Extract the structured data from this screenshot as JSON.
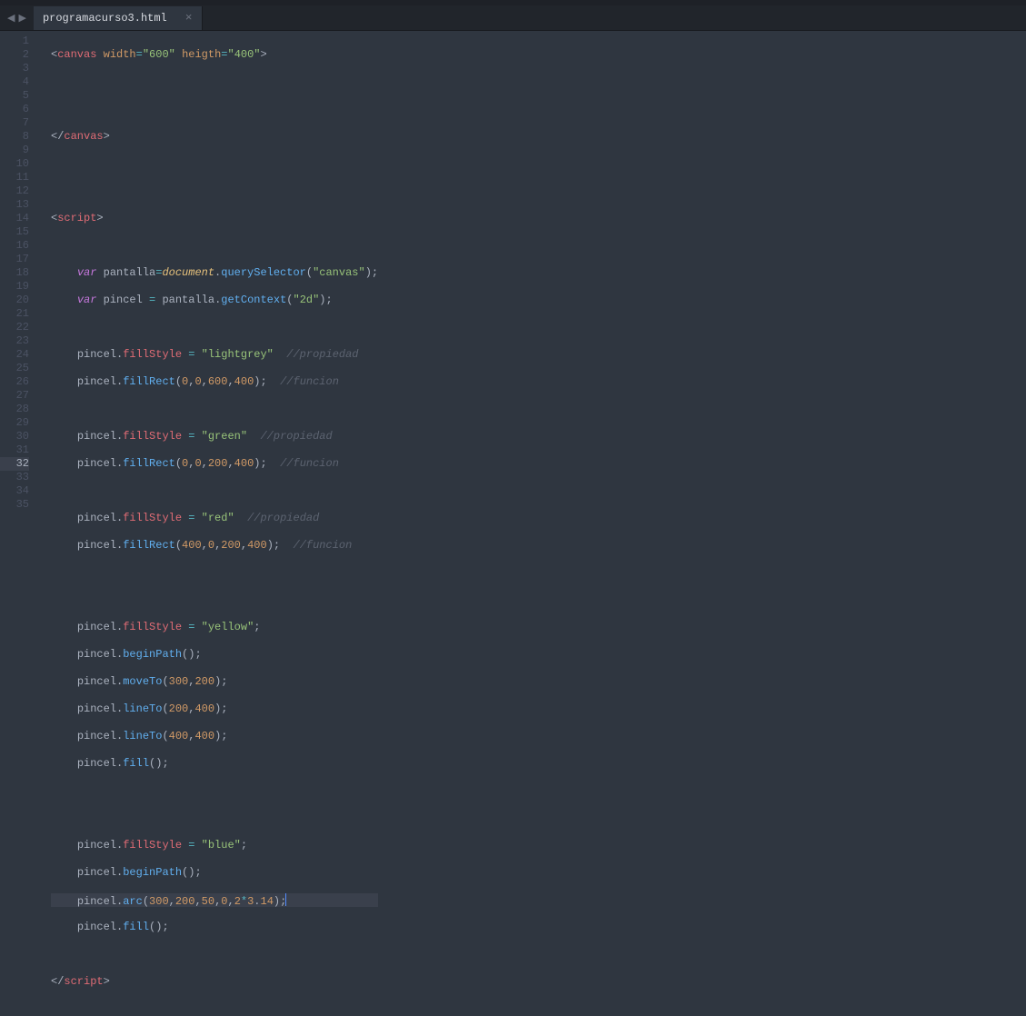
{
  "tab": {
    "filename": "programacurso3.html",
    "close_symbol": "×"
  },
  "nav": {
    "back": "◀",
    "forward": "▶"
  },
  "lines": {
    "total": 35,
    "active": 32
  },
  "code": {
    "canvas_open": "<canvas width=\"600\" heigth=\"400\">",
    "canvas_close": "</canvas>",
    "script_open": "<script>",
    "script_close": "</script>",
    "var_pantalla": "var pantalla=document.querySelector(\"canvas\");",
    "var_pincel": "var pincel = pantalla.getContext(\"2d\");",
    "fillStyle_lightgrey": "pincel.fillStyle = \"lightgrey\"  //propiedad",
    "fillRect_1": "pincel.fillRect(0,0,600,400);  //funcion",
    "fillStyle_green": "pincel.fillStyle = \"green\"  //propiedad",
    "fillRect_2": "pincel.fillRect(0,0,200,400);  //funcion",
    "fillStyle_red": "pincel.fillStyle = \"red\"  //propiedad",
    "fillRect_3": "pincel.fillRect(400,0,200,400);  //funcion",
    "fillStyle_yellow": "pincel.fillStyle = \"yellow\";",
    "beginPath_1": "pincel.beginPath();",
    "moveTo": "pincel.moveTo(300,200);",
    "lineTo_1": "pincel.lineTo(200,400);",
    "lineTo_2": "pincel.lineTo(400,400);",
    "fill_1": "pincel.fill();",
    "fillStyle_blue": "pincel.fillStyle = \"blue\";",
    "beginPath_2": "pincel.beginPath();",
    "arc": "pincel.arc(300,200,50,0,2*3.14);",
    "fill_2": "pincel.fill();"
  },
  "values": {
    "width": "600",
    "height": "400",
    "lightgrey": "lightgrey",
    "green": "green",
    "red": "red",
    "yellow": "yellow",
    "blue": "blue",
    "canvas_sel": "canvas",
    "context_2d": "2d",
    "propiedad": "//propiedad",
    "funcion": "//funcion",
    "n0": "0",
    "n200": "200",
    "n300": "300",
    "n400": "400",
    "n600": "600",
    "n50": "50",
    "n2": "2",
    "n3": "3",
    "n14": "14",
    "pantalla": "pantalla",
    "pincel": "pincel",
    "document": "document",
    "querySelector": "querySelector",
    "getContext": "getContext",
    "fillStyle": "fillStyle",
    "fillRect": "fillRect",
    "beginPath": "beginPath",
    "moveTo": "moveTo",
    "lineTo": "lineTo",
    "fill": "fill",
    "arc": "arc",
    "var": "var",
    "canvas": "canvas",
    "script": "script",
    "width_attr": "width",
    "height_attr": "heigth"
  }
}
